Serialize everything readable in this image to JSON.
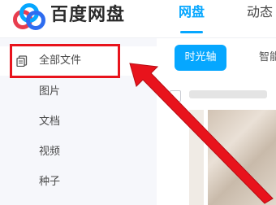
{
  "header": {
    "brand": "百度网盘",
    "tabs": [
      {
        "label": "网盘",
        "active": true
      },
      {
        "label": "动态",
        "active": false
      }
    ]
  },
  "sidebar": {
    "items": [
      {
        "label": "全部文件",
        "icon": "file-copy-icon",
        "active": true
      },
      {
        "label": "图片",
        "active": false
      },
      {
        "label": "文档",
        "active": false
      },
      {
        "label": "视频",
        "active": false
      },
      {
        "label": "种子",
        "active": false
      }
    ]
  },
  "main": {
    "chips": [
      {
        "label": "时光轴",
        "active": true
      },
      {
        "label": "智能",
        "active": false
      }
    ]
  },
  "colors": {
    "accent": "#06a7ff",
    "annotation_red": "#e8131c",
    "sidebar_bg": "#f6f7fb"
  }
}
